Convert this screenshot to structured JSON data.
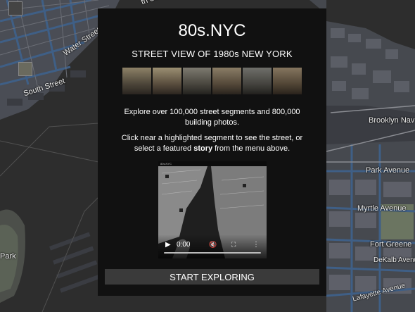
{
  "map": {
    "labels": {
      "south_street": "South Street",
      "water_street": "Water Street",
      "park": "Park",
      "brooklyn_navy": "Brooklyn Nav",
      "park_avenue": "Park Avenue",
      "myrtle_avenue": "Myrtle Avenue",
      "fort_greene": "Fort Greene",
      "dekalb_avenue": "DeKalb Avenue",
      "lafayette_avenue": "Lafayette Avenue",
      "top_street_fragment": "th Street"
    }
  },
  "panel": {
    "title": "80s.NYC",
    "subtitle": "STREET VIEW OF 1980s NEW YORK",
    "intro": "Explore over 100,000 street segments and 800,000 building photos.",
    "instruction_before": "Click near a highlighted segment to see the street, or select a featured ",
    "instruction_bold": "story",
    "instruction_after": " from the menu above.",
    "video": {
      "top_logo": "80s.NYC",
      "time": "0:00",
      "progress": 0
    },
    "start_button": "START EXPLORING"
  },
  "colors": {
    "panel_bg": "#111111",
    "map_bg": "#2a2a2a",
    "button_bg": "#3a3a3a",
    "segment_blue": "#3f5f86"
  }
}
